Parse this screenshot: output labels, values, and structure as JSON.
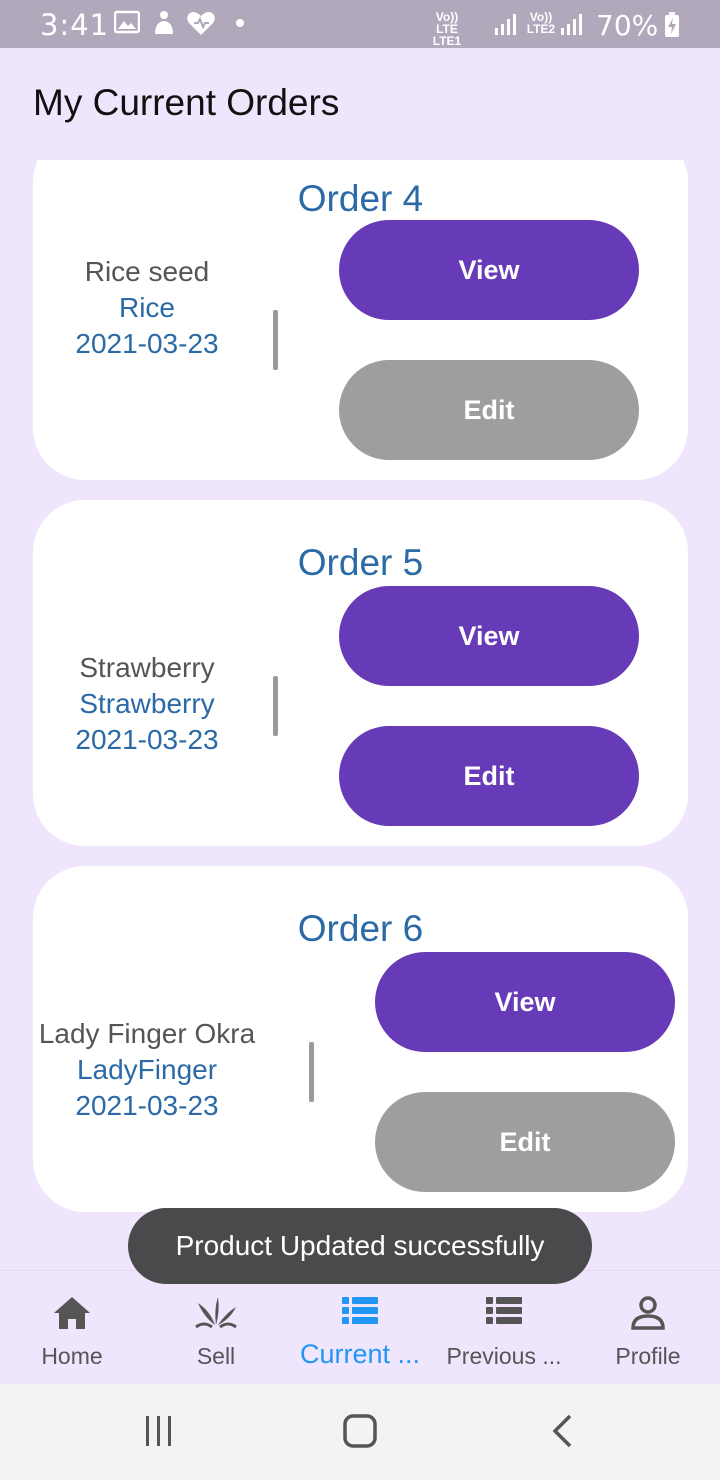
{
  "status_bar": {
    "time": "3:41",
    "net1_top": "Vo)) LTE",
    "net1_bottom": "LTE1 ↓↑",
    "net2_top": "Vo))",
    "net2_bottom": "LTE2",
    "battery": "70%"
  },
  "header": {
    "title": "My Current Orders"
  },
  "orders": [
    {
      "title": "Order 4",
      "product": "Rice seed",
      "type": "Rice",
      "date": "2021-03-23",
      "view_label": "View",
      "edit_label": "Edit"
    },
    {
      "title": "Order 5",
      "product": "Strawberry",
      "type": "Strawberry",
      "date": "2021-03-23",
      "view_label": "View",
      "edit_label": "Edit"
    },
    {
      "title": "Order 6",
      "product": "Lady Finger Okra",
      "type": "LadyFinger",
      "date": "2021-03-23",
      "view_label": "View",
      "edit_label": "Edit"
    }
  ],
  "toast": {
    "message": "Product Updated successfully"
  },
  "bottom_nav": {
    "items": [
      {
        "label": "Home",
        "icon": "home-icon",
        "active": false
      },
      {
        "label": "Sell",
        "icon": "plant-icon",
        "active": false
      },
      {
        "label": "Current ...",
        "icon": "list-icon",
        "active": true
      },
      {
        "label": "Previous ...",
        "icon": "list-icon",
        "active": false
      },
      {
        "label": "Profile",
        "icon": "person-icon",
        "active": false
      }
    ]
  },
  "colors": {
    "accent_purple": "#673ab7",
    "disabled_grey": "#9e9e9e",
    "active_blue": "#2196f3",
    "order_blue": "#2b6aa6",
    "background": "#efe6fd"
  }
}
